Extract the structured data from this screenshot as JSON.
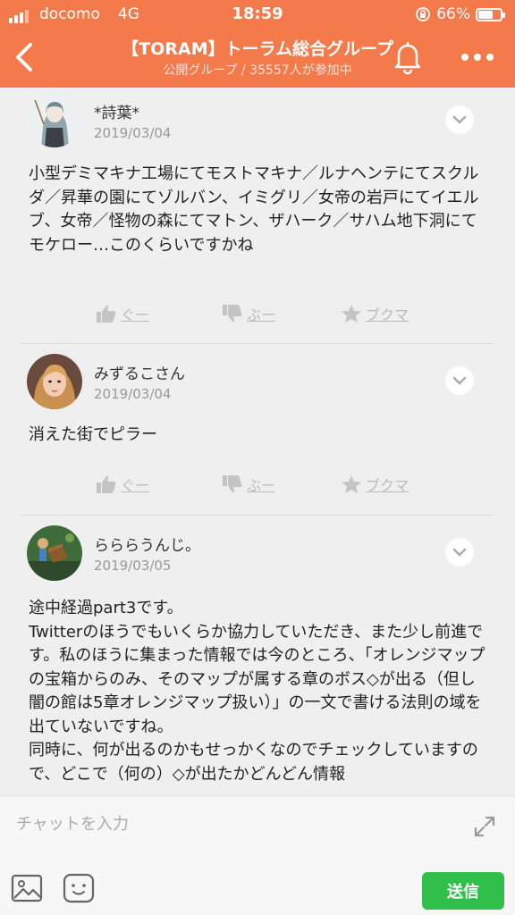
{
  "status_bar": {
    "carrier": "docomo",
    "network": "4G",
    "time": "18:59",
    "battery": "66%",
    "battery_level": 0.66,
    "signal_bars": 3
  },
  "header": {
    "title": "【TORAM】トーラム総合グループ",
    "subtitle": "公開グループ / 35557人が参加中"
  },
  "posts": [
    {
      "username": "*詩葉*",
      "date": "2019/03/04",
      "text": "小型デミマキナ工場にてモストマキナ／ルナヘンテにてスクルダ／昇華の園にてゾルバン、イミグリ／女帝の岩戸にてイエルブ、女帝／怪物の森にてマトン、ザハーク／サハム地下洞にてモケロー…このくらいですかね"
    },
    {
      "username": "みずるこさん",
      "date": "2019/03/04",
      "text": "消えた街でピラー"
    },
    {
      "username": "らららうんじ。",
      "date": "2019/03/05",
      "text": "途中経過part3です。\nTwitterのほうでもいくらか協力していただき、また少し前進です。私のほうに集まった情報では今のところ、「オレンジマップの宝箱からのみ、そのマップが属する章のボス◇が出る（但し闇の館は5章オレンジマップ扱い）」の一文で書ける法則の域を出ていないですね。\n同時に、何が出るのかもせっかくなのでチェックしていますので、どこで（何の）◇が出たかどんどん情報"
    }
  ],
  "actions": {
    "like": "ぐー",
    "dislike": "ぶー",
    "bookmark": "ブクマ"
  },
  "composer": {
    "placeholder": "チャットを入力",
    "send_label": "送信"
  },
  "colors": {
    "brand": "#f47a4b",
    "send": "#2fbf4a",
    "background": "#efefef"
  }
}
